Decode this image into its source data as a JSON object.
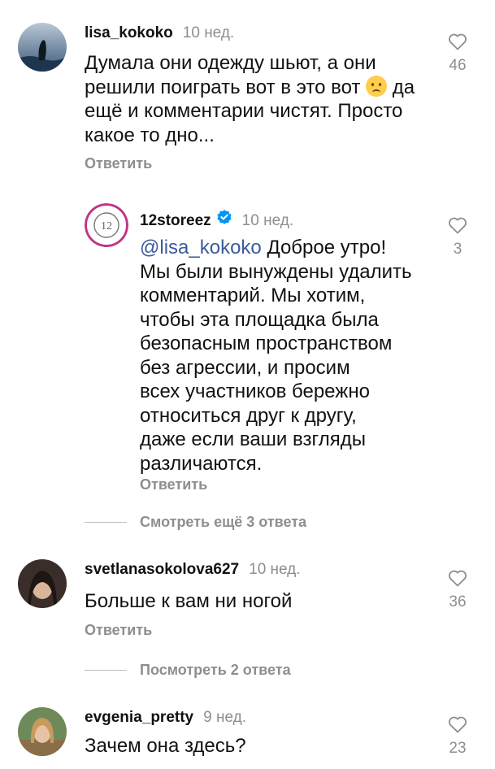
{
  "comments": [
    {
      "username": "lisa_kokoko",
      "time": "10 нед.",
      "lines": [
        "Думала они одежду шьют, а они",
        "решили поиграть вот в это вот",
        "да",
        "ещё и комментарии чистят. Просто",
        "какое то дно..."
      ],
      "emoji": "crying-face",
      "likes": "46",
      "reply_label": "Ответить"
    },
    {
      "username": "12storeez",
      "verified": true,
      "time": "10 нед.",
      "mention": "@lisa_kokoko",
      "lines": [
        "Доброе утро!",
        "Мы были вынуждены удалить",
        "комментарий. Мы хотим,",
        "чтобы эта площадка была",
        "безопасным пространством",
        "без агрессии, и просим",
        "всех участников бережно",
        "относиться друг к другу,",
        "даже если ваши взгляды",
        "различаются."
      ],
      "likes": "3",
      "reply_label": "Ответить",
      "brand_color": "#c13584"
    },
    {
      "username": "svetlanasokolova627",
      "time": "10 нед.",
      "lines": [
        "Больше к вам ни ногой"
      ],
      "likes": "36",
      "reply_label": "Ответить"
    },
    {
      "username": "evgenia_pretty",
      "time": "9 нед.",
      "lines": [
        "Зачем она здесь?"
      ],
      "likes": "23"
    }
  ],
  "threads": {
    "view_more_label": "Смотреть ещё 3 ответа",
    "view_replies_label": "Посмотреть 2 ответа"
  },
  "icons": {
    "like": "heart-outline-icon",
    "verified": "verified-badge-icon"
  },
  "colors": {
    "verified": "#0095f6",
    "muted": "#8e8e8e"
  }
}
